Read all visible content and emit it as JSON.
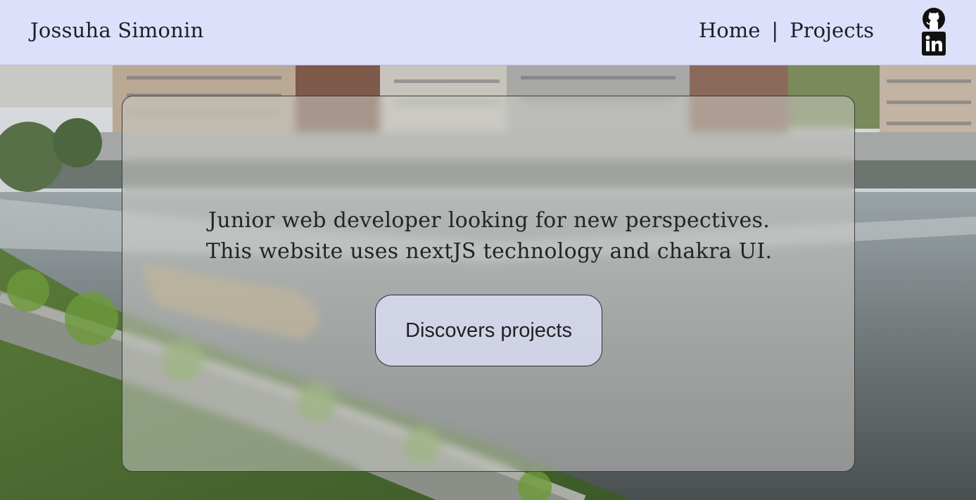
{
  "header": {
    "brand": "Jossuha Simonin",
    "nav": [
      {
        "label": "Home"
      },
      {
        "label": "Projects"
      }
    ],
    "separator": "|",
    "social": [
      {
        "icon": "github-icon"
      },
      {
        "icon": "linkedin-icon"
      }
    ]
  },
  "hero": {
    "line1": "Junior web developer looking for new perspectives.",
    "line2": "This website uses nextJS technology and chakra UI.",
    "cta_label": "Discovers projects"
  },
  "colors": {
    "header_bg": "#dde0fb",
    "text": "#1f1f24",
    "card_bg": "rgba(205,205,200,0.52)",
    "button_bg": "#dcdef5"
  }
}
